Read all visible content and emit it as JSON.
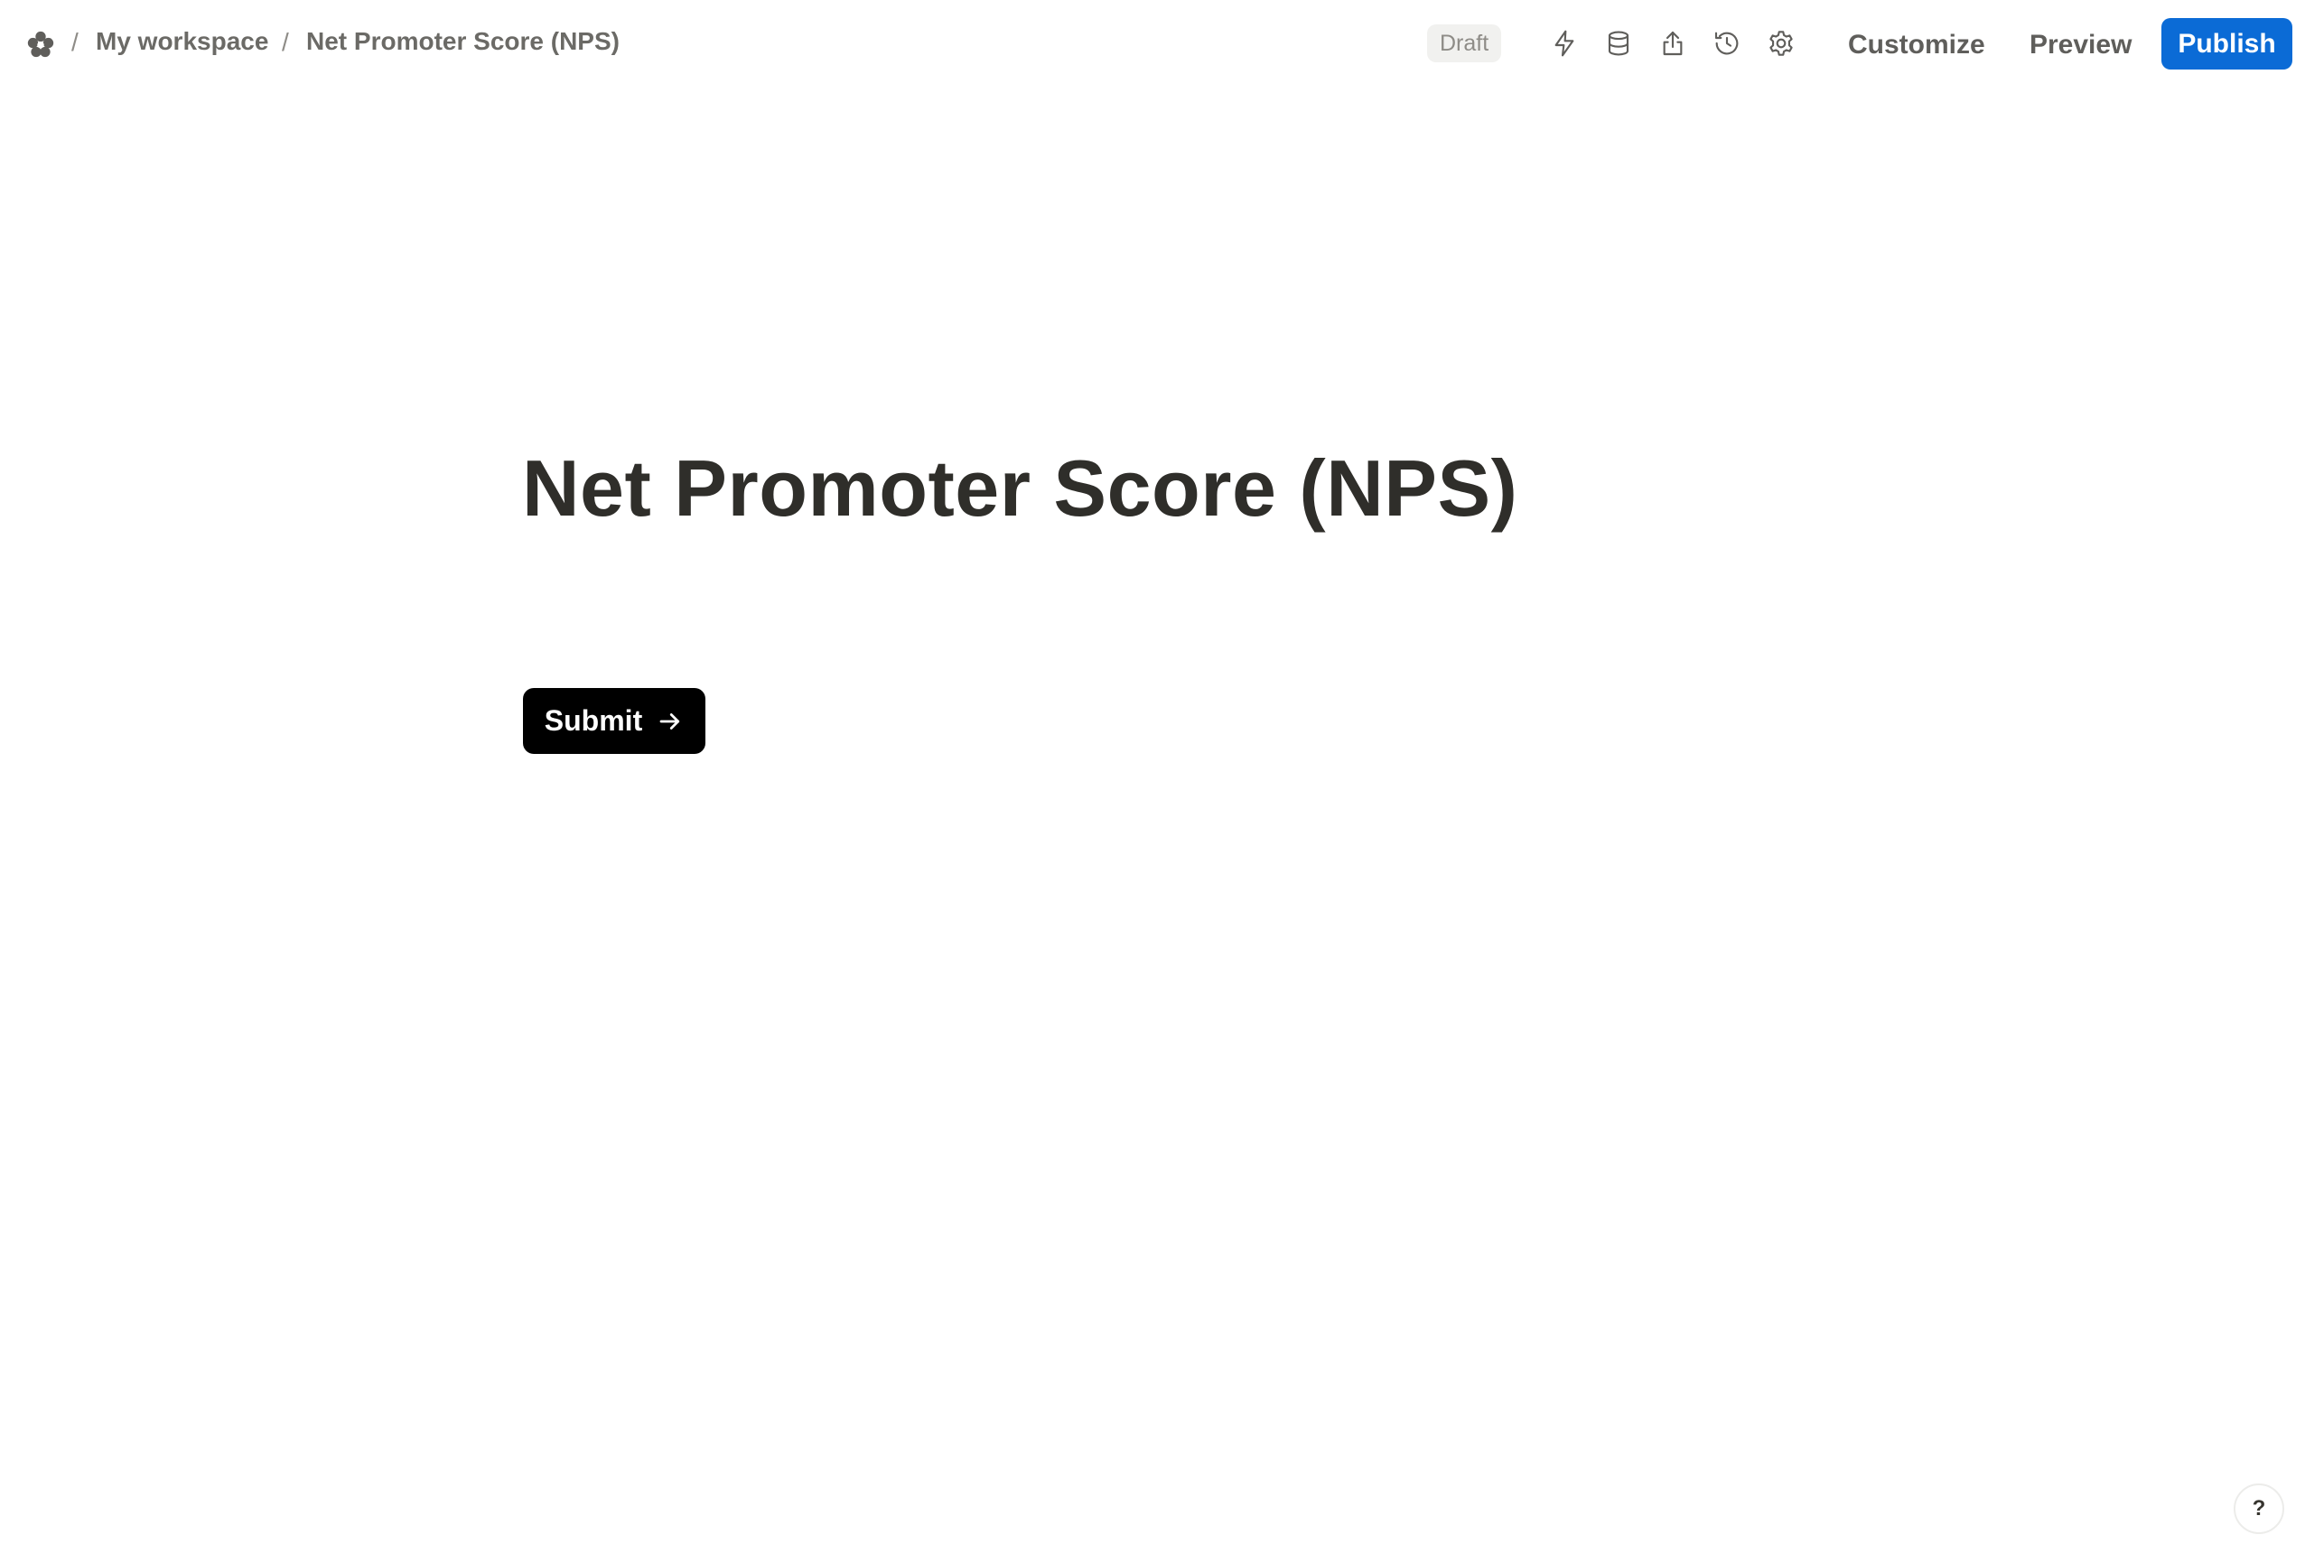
{
  "breadcrumb": {
    "separator": "/",
    "workspace": "My workspace",
    "form_name": "Net Promoter Score (NPS)"
  },
  "status": {
    "label": "Draft"
  },
  "toolbar": {
    "icons": [
      "lightning-icon",
      "database-icon",
      "share-icon",
      "history-icon",
      "gear-icon"
    ],
    "customize_label": "Customize",
    "preview_label": "Preview",
    "publish_label": "Publish"
  },
  "form": {
    "title": "Net Promoter Score (NPS)",
    "submit_label": "Submit"
  },
  "help": {
    "label": "?"
  },
  "colors": {
    "publish": "#0b6bd6",
    "submit": "#000000",
    "title_text": "#2f2e2a"
  }
}
